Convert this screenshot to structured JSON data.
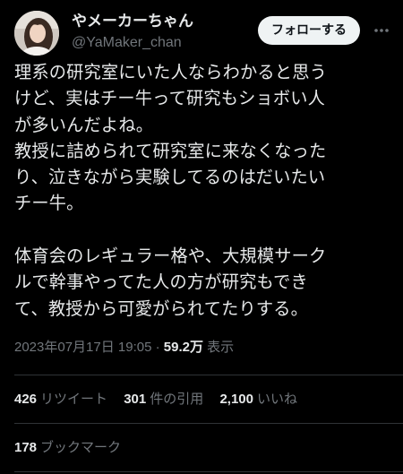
{
  "author": {
    "display_name": "やメーカーちゃん",
    "handle": "@YaMaker_chan",
    "avatar_icon": "profile-photo"
  },
  "follow_button": {
    "label": "フォローする"
  },
  "more_icon": "more-dots-icon",
  "tweet": {
    "lines": [
      "理系の研究室にいた人ならわかると思う",
      "けど、実はチー牛って研究もショボい人",
      "が多いんだよね。",
      "教授に詰められて研究室に来なくなった",
      "り、泣きながら実験してるのはだいたい",
      "チー牛。",
      "",
      "体育会のレギュラー格や、大規模サーク",
      "ルで幹事やってた人の方が研究もでき",
      "て、教授から可愛がられてたりする。"
    ]
  },
  "meta": {
    "timestamp": "2023年07月17日 19:05",
    "separator": "·",
    "views_count": "59.2万",
    "views_label": "表示"
  },
  "stats": {
    "retweets": {
      "count": "426",
      "label": "リツイート"
    },
    "quotes": {
      "count": "301",
      "label": "件の引用"
    },
    "likes": {
      "count": "2,100",
      "label": "いいね"
    },
    "bookmarks": {
      "count": "178",
      "label": "ブックマーク"
    }
  },
  "colors": {
    "background": "#000000",
    "text_primary": "#e7e9ea",
    "text_secondary": "#71767b",
    "divider": "#2f3336",
    "follow_button_bg": "#eff3f4"
  }
}
